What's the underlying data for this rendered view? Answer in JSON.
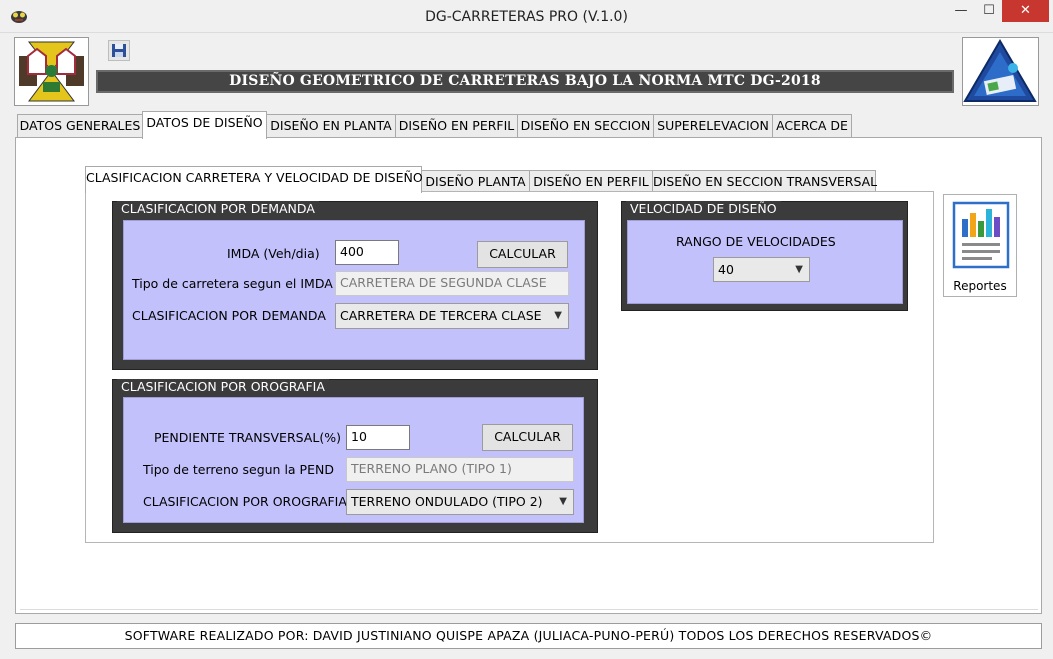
{
  "window": {
    "title": "DG-CARRETERAS PRO (V.1.0)",
    "minimize_glyph": "—",
    "maximize_glyph": "☐",
    "close_glyph": "✕"
  },
  "header": {
    "banner": "DISEÑO GEOMETRICO DE CARRETERAS BAJO LA NORMA MTC DG-2018"
  },
  "main_tabs": [
    {
      "label": "DATOS GENERALES",
      "active": false
    },
    {
      "label": "DATOS DE DISEÑO",
      "active": true
    },
    {
      "label": "DISEÑO EN PLANTA",
      "active": false
    },
    {
      "label": "DISEÑO EN PERFIL",
      "active": false
    },
    {
      "label": "DISEÑO EN SECCION",
      "active": false
    },
    {
      "label": "SUPERELEVACION",
      "active": false
    },
    {
      "label": "ACERCA DE",
      "active": false
    }
  ],
  "sub_tabs": [
    {
      "label": "CLASIFICACION CARRETERA Y VELOCIDAD DE DISEÑO",
      "active": true
    },
    {
      "label": "DISEÑO PLANTA",
      "active": false
    },
    {
      "label": "DISEÑO EN PERFIL",
      "active": false
    },
    {
      "label": "DISEÑO EN SECCION TRANSVERSAL",
      "active": false
    }
  ],
  "demanda": {
    "title": "CLASIFICACION POR DEMANDA",
    "imda_label": "IMDA (Veh/dia)",
    "imda_value": "400",
    "calcular_label": "CALCULAR",
    "tipo_label": "Tipo de carretera segun el IMDA",
    "tipo_value": "CARRETERA DE SEGUNDA CLASE",
    "clasif_label": "CLASIFICACION POR DEMANDA",
    "clasif_value": "CARRETERA DE TERCERA CLASE"
  },
  "orografia": {
    "title": "CLASIFICACION POR OROGRAFIA",
    "pendiente_label": "PENDIENTE TRANSVERSAL(%)",
    "pendiente_value": "10",
    "calcular_label": "CALCULAR",
    "tipo_label": "Tipo de terreno segun la PEND",
    "tipo_value": "TERRENO PLANO (TIPO 1)",
    "clasif_label": "CLASIFICACION POR OROGRAFIA",
    "clasif_value": "TERRENO ONDULADO (TIPO 2)"
  },
  "velocidad": {
    "title": "VELOCIDAD DE DISEÑO",
    "rango_label": "RANGO DE VELOCIDADES",
    "rango_value": "40"
  },
  "reportes_label": "Reportes",
  "footer": "SOFTWARE REALIZADO POR: DAVID JUSTINIANO QUISPE APAZA (JULIACA-PUNO-PERÚ) TODOS LOS DERECHOS RESERVADOS©"
}
